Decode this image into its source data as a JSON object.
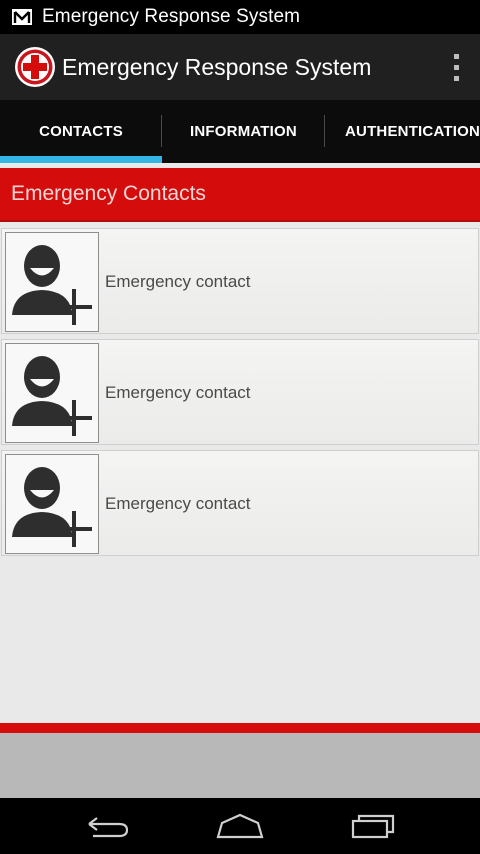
{
  "status_bar": {
    "notification_icon": "gmail-icon",
    "title": "Emergency Response System"
  },
  "action_bar": {
    "logo_icon": "red-cross-icon",
    "title": "Emergency Response System",
    "menu_icon": "overflow-menu-icon"
  },
  "tabs": [
    {
      "label": "CONTACTS",
      "selected": true
    },
    {
      "label": "INFORMATION",
      "selected": false
    },
    {
      "label": "AUTHENTICATION",
      "selected": false
    }
  ],
  "section": {
    "title": "Emergency Contacts"
  },
  "contacts": [
    {
      "label": "Emergency contact",
      "icon": "add-contact-icon"
    },
    {
      "label": "Emergency contact",
      "icon": "add-contact-icon"
    },
    {
      "label": "Emergency contact",
      "icon": "add-contact-icon"
    }
  ],
  "nav_bar": {
    "back_icon": "back-icon",
    "home_icon": "home-icon",
    "recents_icon": "recent-apps-icon"
  },
  "colors": {
    "accent_red": "#d40c0c",
    "tab_indicator": "#33b5e5",
    "action_bar": "#202020"
  }
}
